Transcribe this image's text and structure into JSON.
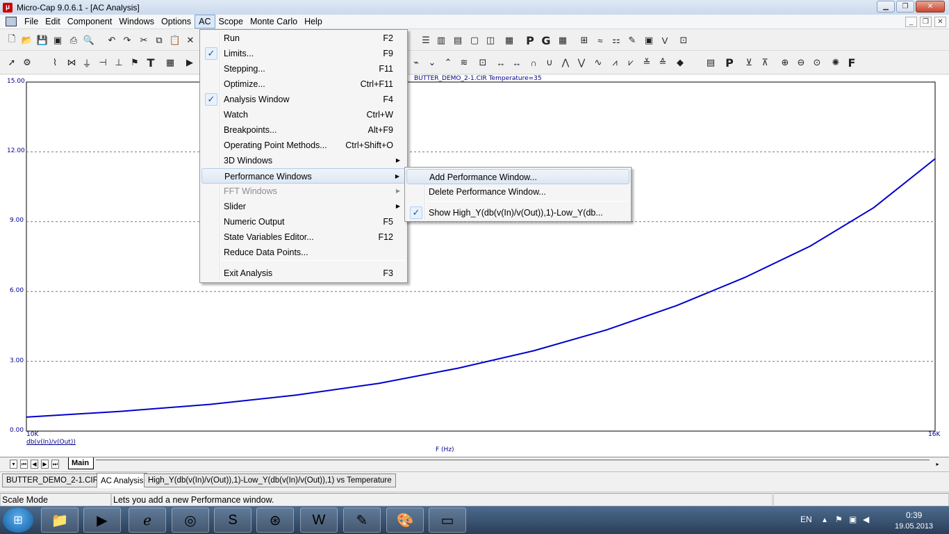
{
  "window": {
    "title": "Micro-Cap 9.0.6.1 - [AC Analysis]",
    "app_icon": "microcap-icon",
    "controls": [
      "minimize",
      "maximize",
      "close"
    ]
  },
  "menubar": {
    "items": [
      "File",
      "Edit",
      "Component",
      "Windows",
      "Options",
      "AC",
      "Scope",
      "Monte Carlo",
      "Help"
    ],
    "active": "AC"
  },
  "ac_menu": {
    "items": [
      {
        "label": "Run",
        "shortcut": "F2",
        "checked": false,
        "submenu": false,
        "disabled": false
      },
      {
        "label": "Limits...",
        "shortcut": "F9",
        "checked": true,
        "submenu": false,
        "disabled": false
      },
      {
        "label": "Stepping...",
        "shortcut": "F11",
        "checked": false,
        "submenu": false,
        "disabled": false
      },
      {
        "label": "Optimize...",
        "shortcut": "Ctrl+F11",
        "checked": false,
        "submenu": false,
        "disabled": false
      },
      {
        "label": "Analysis Window",
        "shortcut": "F4",
        "checked": true,
        "submenu": false,
        "disabled": false
      },
      {
        "label": "Watch",
        "shortcut": "Ctrl+W",
        "checked": false,
        "submenu": false,
        "disabled": false
      },
      {
        "label": "Breakpoints...",
        "shortcut": "Alt+F9",
        "checked": false,
        "submenu": false,
        "disabled": false
      },
      {
        "label": "Operating Point Methods...",
        "shortcut": "Ctrl+Shift+O",
        "checked": false,
        "submenu": false,
        "disabled": false
      },
      {
        "label": "3D Windows",
        "shortcut": "",
        "checked": false,
        "submenu": true,
        "disabled": false
      },
      {
        "label": "Performance Windows",
        "shortcut": "",
        "checked": false,
        "submenu": true,
        "disabled": false,
        "highlight": true
      },
      {
        "label": "FFT Windows",
        "shortcut": "",
        "checked": false,
        "submenu": true,
        "disabled": true
      },
      {
        "label": "Slider",
        "shortcut": "",
        "checked": false,
        "submenu": true,
        "disabled": false
      },
      {
        "label": "Numeric Output",
        "shortcut": "F5",
        "checked": false,
        "submenu": false,
        "disabled": false
      },
      {
        "label": "State Variables Editor...",
        "shortcut": "F12",
        "checked": false,
        "submenu": false,
        "disabled": false
      },
      {
        "label": "Reduce Data Points...",
        "shortcut": "",
        "checked": false,
        "submenu": false,
        "disabled": false
      },
      {
        "label": "Exit Analysis",
        "shortcut": "F3",
        "checked": false,
        "submenu": false,
        "disabled": false
      }
    ]
  },
  "perf_menu": {
    "items": [
      {
        "label": "Add Performance Window...",
        "checked": false,
        "highlight": true
      },
      {
        "label": "Delete Performance Window...",
        "checked": false,
        "highlight": false
      },
      {
        "label": "Show High_Y(db(v(In)/v(Out)),1)-Low_Y(db...",
        "checked": true,
        "highlight": false
      }
    ]
  },
  "plot": {
    "header": "BUTTER_DEMO_2-1.CIR Temperature=35",
    "y_ticks": [
      "15.00",
      "12.00",
      "9.00",
      "6.00",
      "3.00",
      "0.00"
    ],
    "x_start": "10K",
    "x_end": "16K",
    "x_label": "F (Hz)",
    "trace_label": "db(v(In)/v(Out))",
    "trace_color": "#0000cc"
  },
  "chart_data": {
    "type": "line",
    "title": "BUTTER_DEMO_2-1.CIR Temperature=35",
    "xlabel": "F (Hz)",
    "ylabel": "",
    "xlim": [
      10000,
      16000
    ],
    "ylim": [
      0,
      15
    ],
    "x_scale": "log",
    "grid": true,
    "series": [
      {
        "name": "db(v(In)/v(Out))",
        "color": "#0000cc",
        "x": [
          10000,
          10500,
          11000,
          11500,
          12000,
          12500,
          13000,
          13500,
          14000,
          14500,
          15000,
          15500,
          16000
        ],
        "y": [
          0.6,
          0.85,
          1.15,
          1.55,
          2.05,
          2.7,
          3.45,
          4.35,
          5.4,
          6.6,
          7.95,
          9.6,
          11.7
        ]
      }
    ]
  },
  "sheet_tabs": {
    "active": "Main"
  },
  "doc_tabs": {
    "items": [
      "BUTTER_DEMO_2-1.CIR",
      "AC Analysis",
      "High_Y(db(v(In)/v(Out)),1)-Low_Y(db(v(In)/v(Out)),1) vs Temperature"
    ],
    "active": "AC Analysis"
  },
  "status": {
    "mode": "Scale Mode",
    "message": "Lets you add a new Performance window."
  },
  "taskbar": {
    "apps": [
      "explorer-icon",
      "media-player-icon",
      "internet-explorer-icon",
      "chrome-icon",
      "skype-icon",
      "app-icon",
      "word-icon",
      "microcap-task-icon",
      "paint-icon",
      "notepad-icon"
    ],
    "language": "EN",
    "time": "0:39",
    "date": "19.05.2013"
  }
}
